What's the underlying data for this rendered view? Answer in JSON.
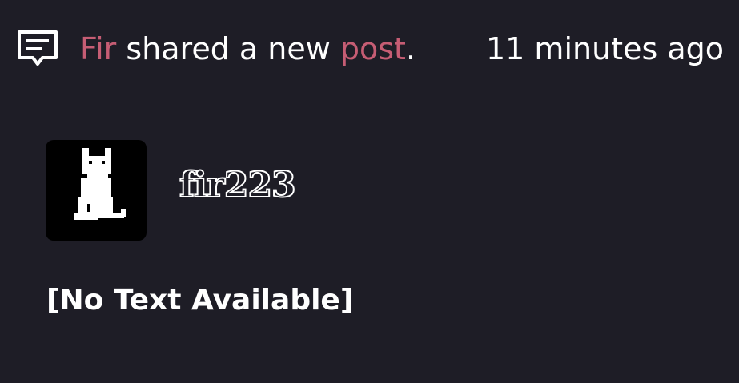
{
  "activity": {
    "icon": "comment-icon",
    "actor": "Fir",
    "action": " shared a new ",
    "object": "post",
    "end": ".",
    "timestamp": "11 minutes ago"
  },
  "post": {
    "author_avatar": "pixel-cat-avatar",
    "author": "fir223",
    "body": "[No Text Available]"
  },
  "colors": {
    "background": "#1e1d26",
    "link": "#c65d74",
    "text": "#ffffff"
  }
}
